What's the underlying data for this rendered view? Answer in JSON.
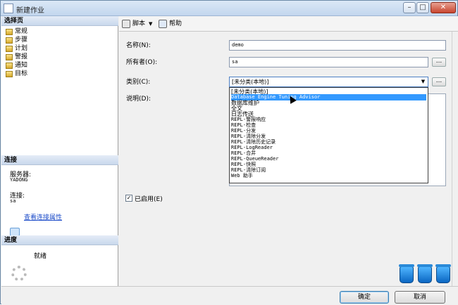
{
  "window": {
    "title": "新建作业",
    "min": "–",
    "max": "□",
    "close": "✕"
  },
  "left": {
    "select_page_header": "选择页",
    "pages": [
      "常规",
      "步骤",
      "计划",
      "警报",
      "通知",
      "目标"
    ],
    "connection_header": "连接",
    "server_label": "服务器:",
    "server_value": "YADONG",
    "connection_label": "连接:",
    "connection_value": "sa",
    "view_connection_link": "查看连接属性",
    "progress_header": "进度",
    "progress_status": "就绪"
  },
  "toolbar": {
    "script_label": "脚本",
    "dropdown_arrow": "▼",
    "help_label": "帮助"
  },
  "form": {
    "name_label": "名称(N):",
    "name_value": "demo",
    "owner_label": "所有者(O):",
    "owner_value": "sa",
    "category_label": "类别(C):",
    "category_value": "[未分类(本地)]",
    "description_label": "说明(D):",
    "enabled_label": "已启用(E)",
    "enabled_checked": true,
    "browse_label": "..."
  },
  "category_options": [
    "[未分类(本地)]",
    "Database Engine Tuning Advisor",
    "数据库维护",
    "全文",
    "日志传送",
    "REPL-警报响应",
    "REPL-检查",
    "REPL-分发",
    "REPL-清除分发",
    "REPL-清除历史记录",
    "REPL-LogReader",
    "REPL-合并",
    "REPL-QueueReader",
    "REPL-快照",
    "REPL-清除订阅",
    "Web 助手"
  ],
  "selected_option_index": 1,
  "buttons": {
    "ok": "确定",
    "cancel": "取消"
  },
  "colors": {
    "selection": "#3399ff",
    "link": "#1d4cc9"
  }
}
